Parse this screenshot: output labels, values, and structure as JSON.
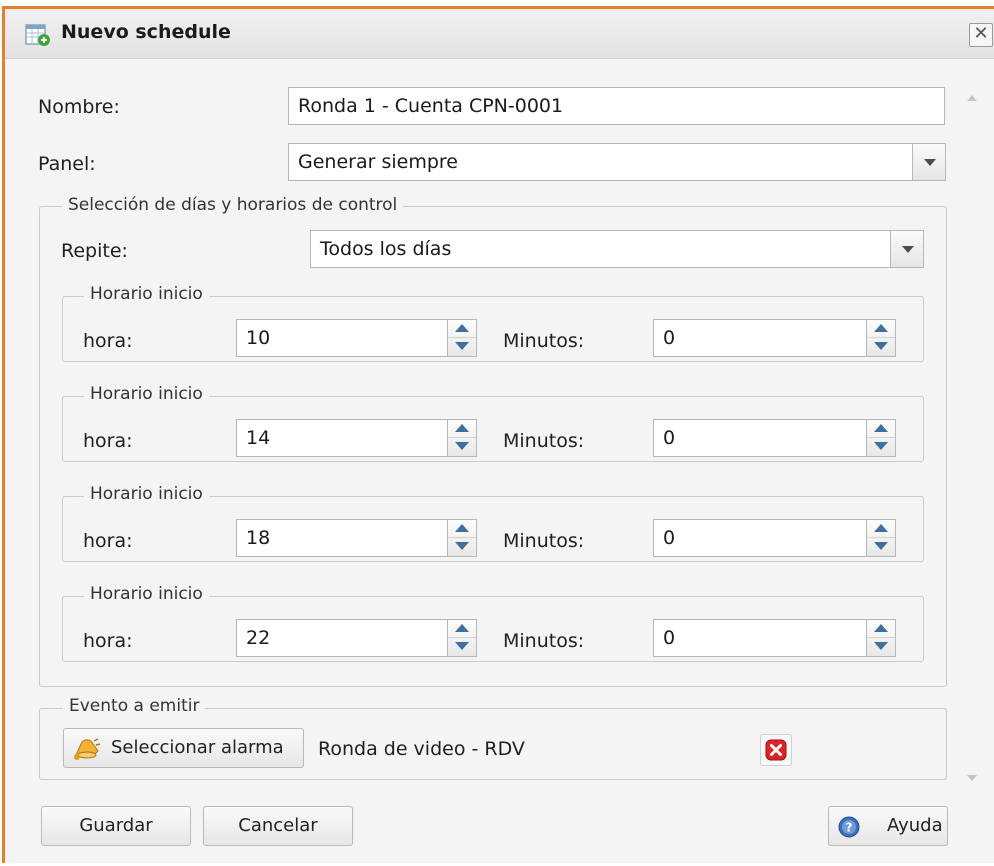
{
  "window": {
    "title": "Nuevo schedule",
    "close_glyph": "✕",
    "title_icon": "calendar-add-icon"
  },
  "form": {
    "nombre": {
      "label": "Nombre:",
      "value": "Ronda 1 - Cuenta CPN-0001"
    },
    "panel": {
      "label": "Panel:",
      "value": "Generar siempre"
    }
  },
  "schedule_section": {
    "legend": "Selección de días y horarios de control",
    "repite": {
      "label": "Repite:",
      "value": "Todos los días"
    },
    "horarios": [
      {
        "legend": "Horario inicio",
        "hora_label": "hora:",
        "hora": "10",
        "minutos_label": "Minutos:",
        "minutos": "0"
      },
      {
        "legend": "Horario inicio",
        "hora_label": "hora:",
        "hora": "14",
        "minutos_label": "Minutos:",
        "minutos": "0"
      },
      {
        "legend": "Horario inicio",
        "hora_label": "hora:",
        "hora": "18",
        "minutos_label": "Minutos:",
        "minutos": "0"
      },
      {
        "legend": "Horario inicio",
        "hora_label": "hora:",
        "hora": "22",
        "minutos_label": "Minutos:",
        "minutos": "0"
      }
    ]
  },
  "evento": {
    "legend": "Evento a emitir",
    "select_button": "Seleccionar alarma",
    "select_icon": "bell-icon",
    "selected_value": "Ronda de video - RDV",
    "remove_icon": "remove-icon"
  },
  "footer": {
    "save": "Guardar",
    "cancel": "Cancelar",
    "help": "Ayuda",
    "help_icon": "help-icon"
  },
  "colors": {
    "window_border": "#e57f2a",
    "spin_arrow": "#3f6f9f",
    "remove_red": "#d8262c"
  }
}
